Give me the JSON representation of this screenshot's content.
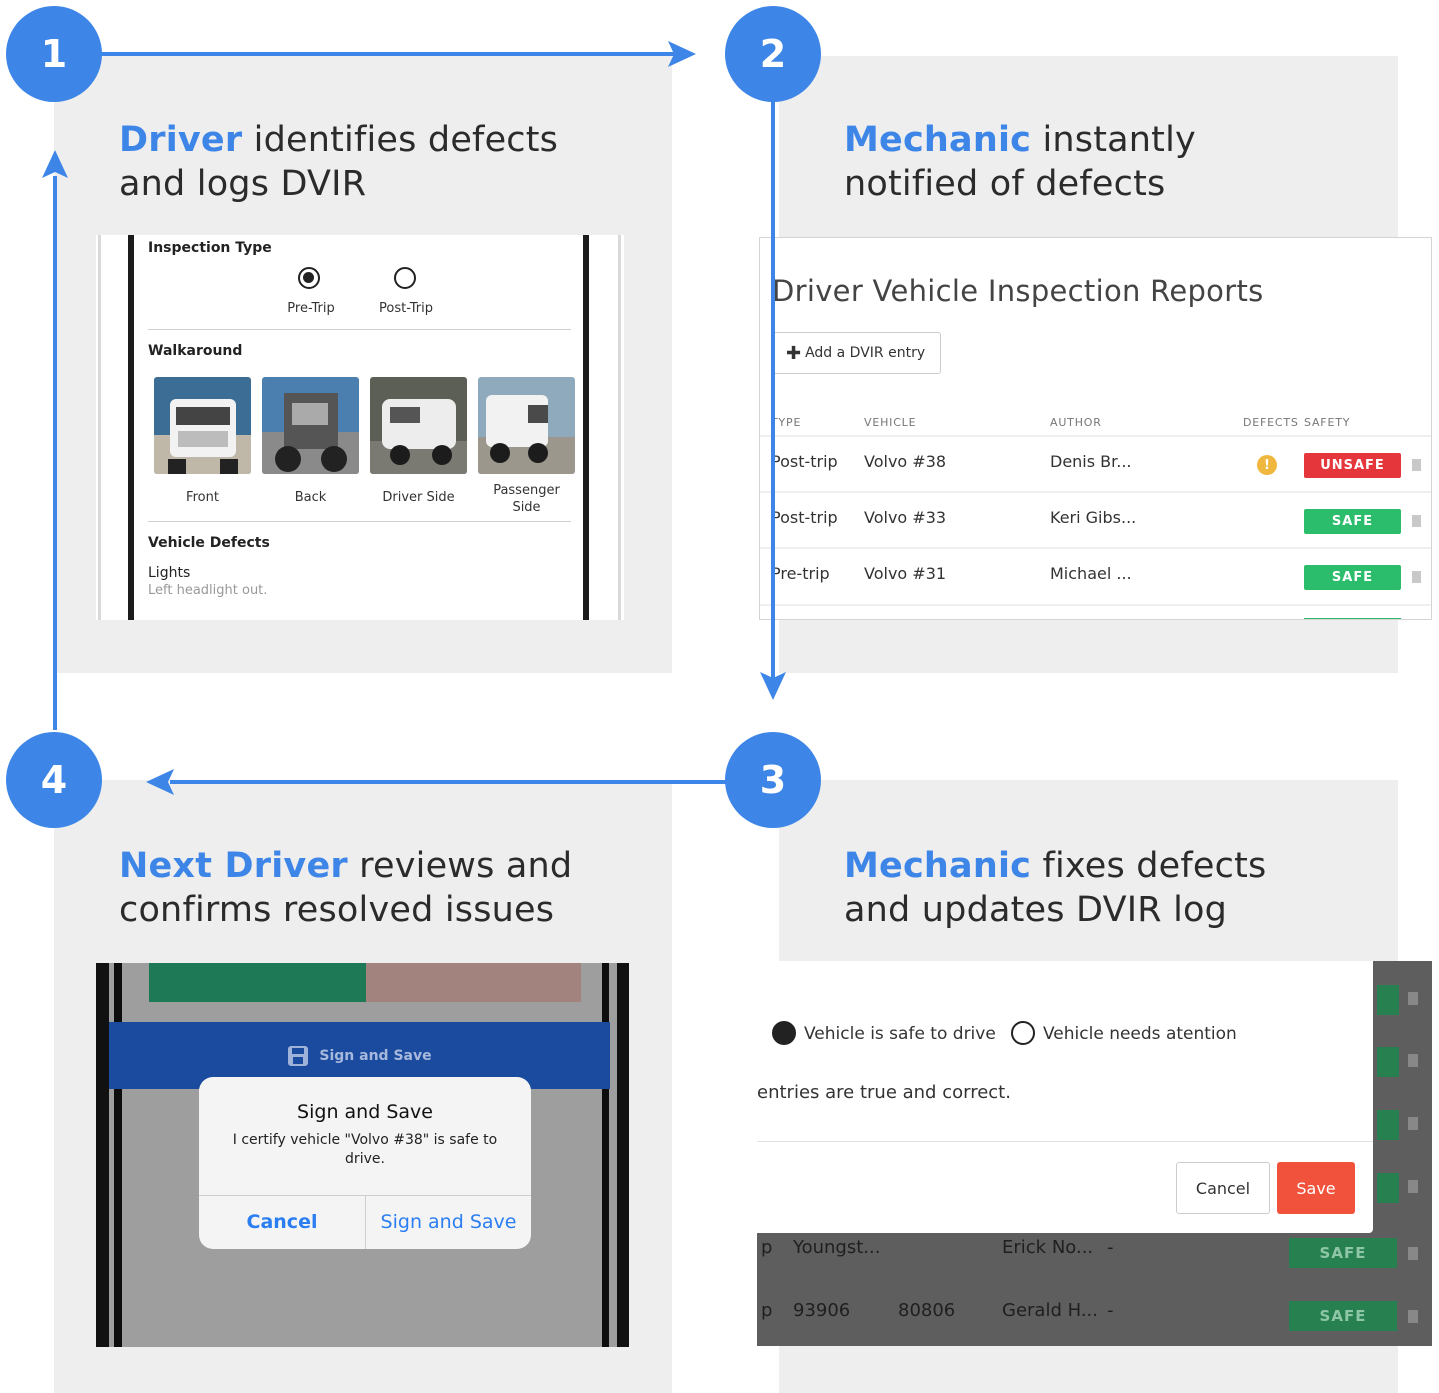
{
  "colors": {
    "accent": "#3d86e8",
    "panel": "#eeeeee",
    "unsafe": "#e5363c",
    "safe": "#2bbd6c",
    "save": "#f0523b",
    "bar": "#1b4b9e"
  },
  "steps": [
    {
      "num": "1",
      "highlight": "Driver",
      "rest": " identifies defects",
      "line2": "and logs DVIR"
    },
    {
      "num": "2",
      "highlight": "Mechanic",
      "rest": " instantly",
      "line2": "notified of defects"
    },
    {
      "num": "3",
      "highlight": "Mechanic",
      "rest": " fixes defects",
      "line2": "and updates DVIR log"
    },
    {
      "num": "4",
      "highlight": "Next Driver",
      "rest": " reviews and",
      "line2": "confirms resolved issues"
    }
  ],
  "phone1": {
    "inspection_type_title": "Inspection Type",
    "pre_trip": "Pre-Trip",
    "post_trip": "Post-Trip",
    "walkaround_title": "Walkaround",
    "photos": [
      "Front",
      "Back",
      "Driver Side",
      "Passenger\nSide"
    ],
    "defects_title": "Vehicle Defects",
    "defect_name": "Lights",
    "defect_note": "Left headlight out."
  },
  "dvir": {
    "title": "Driver Vehicle Inspection Reports",
    "add_label": "Add a DVIR entry",
    "headers": {
      "type": "TYPE",
      "vehicle": "VEHICLE",
      "author": "AUTHOR",
      "defects": "DEFECTS",
      "safety": "SAFETY"
    },
    "rows": [
      {
        "type": "Post-trip",
        "vehicle": "Volvo #38",
        "author": "Denis Br...",
        "defect": "!",
        "safety": "UNSAFE"
      },
      {
        "type": "Post-trip",
        "vehicle": "Volvo #33",
        "author": "Keri Gibs...",
        "defect": "",
        "safety": "SAFE"
      },
      {
        "type": "Pre-trip",
        "vehicle": "Volvo #31",
        "author": "Michael ...",
        "defect": "",
        "safety": "SAFE"
      }
    ]
  },
  "mechanic_modal": {
    "safe_option": "Vehicle is safe to drive",
    "attention_option": "Vehicle needs atention",
    "certify": "entries are true and correct.",
    "cancel": "Cancel",
    "save": "Save",
    "bg_rows": [
      {
        "c1": "p",
        "c2": "Youngst...",
        "c3": "",
        "c4": "Erick No...",
        "c5": "-",
        "badge": "SAFE"
      },
      {
        "c1": "p",
        "c2": "93906",
        "c3": "80806",
        "c4": "Gerald H...",
        "c5": "-",
        "badge": "SAFE"
      }
    ]
  },
  "phone4": {
    "bar_label": "Sign and Save",
    "alert_title": "Sign and Save",
    "alert_body": "I certify vehicle \"Volvo #38\" is safe to drive.",
    "cancel": "Cancel",
    "confirm": "Sign and Save"
  }
}
